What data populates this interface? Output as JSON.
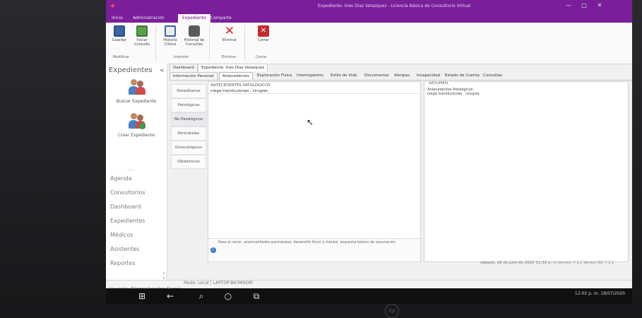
{
  "window": {
    "title": "Expediente: Ines Diaz Velazquez - Licencia Básica de Consultorio Virtual",
    "app_icon": "app-logo-icon"
  },
  "ribbon_tabs": [
    {
      "label": "Inicio"
    },
    {
      "label": "Administración"
    },
    {
      "label": "Expediente"
    },
    {
      "label": "Comparte"
    }
  ],
  "ribbon": {
    "buttons": {
      "guardar": "Guardar",
      "iniciar": "Iniciar Consulta",
      "historia": "Historia Clínica",
      "historial": "Historial de Consultas",
      "eliminar": "Eliminar",
      "cerrar": "Cerrar"
    },
    "groups": {
      "modificar": "Modificar",
      "imprimir": "Imprimir",
      "eliminar": "Eliminar",
      "cerrar": "Cerrar"
    }
  },
  "leftnav": {
    "header": "Expedientes",
    "arrow": "<",
    "actions": {
      "buscar": "Buscar Expediente",
      "crear": "Crear Expediente"
    },
    "ellipsis": ".....",
    "items": [
      {
        "label": "Agenda"
      },
      {
        "label": "Consultorios"
      },
      {
        "label": "Dashboard"
      },
      {
        "label": "Expedientes"
      },
      {
        "label": "Médicos"
      },
      {
        "label": "Asistentes"
      },
      {
        "label": "Reportes"
      }
    ],
    "more": "• • •"
  },
  "doc_tabs": [
    {
      "label": "Dashboard"
    },
    {
      "label": "Expediente: Ines Diaz Velazquez"
    }
  ],
  "sub_tabs": [
    {
      "label": "Información Personal"
    },
    {
      "label": "Antecedentes"
    },
    {
      "label": "Exploración Física"
    },
    {
      "label": "Interrogatorio"
    },
    {
      "label": "Estilo de Vida"
    },
    {
      "label": "Documentos"
    },
    {
      "label": "Alergias"
    },
    {
      "label": "Incapacidad"
    },
    {
      "label": "Estado de Cuenta"
    },
    {
      "label": "Consultas"
    }
  ],
  "subnav": [
    {
      "label": "Hereditarios"
    },
    {
      "label": "Patológicos"
    },
    {
      "label": "No Patológicos"
    },
    {
      "label": "Perinatales"
    },
    {
      "label": "Ginecológicos"
    },
    {
      "label": "Obstétricos"
    }
  ],
  "panel": {
    "title": "ANTECEDENTES PATOLÓGICOS",
    "text": "niega transfuciones , cirugias"
  },
  "hint": {
    "text": "Peso al nacer, anormalidades perinatales, desarrollo físico y mental, esquema básico de vacunación"
  },
  "resumen": {
    "title": "RESUMEN",
    "line1": "Antecedentes Patológicos:",
    "line2": "niega transfuciones , cirugias"
  },
  "status": {
    "user": "Usuario: BlancaAguilar Garcia",
    "mode": "Modo: Local | LAPTOP-B63M0OIR",
    "date": "sábado, 18 de julio de 2020   11:32 a. m.",
    "version": "Versión: 7.1.1   Versión BD: 7.1.1"
  },
  "taskbar": {
    "clock": "12:02 p. m.",
    "date": "18/07/2020"
  },
  "colors": {
    "accent": "#7a1e9a"
  }
}
